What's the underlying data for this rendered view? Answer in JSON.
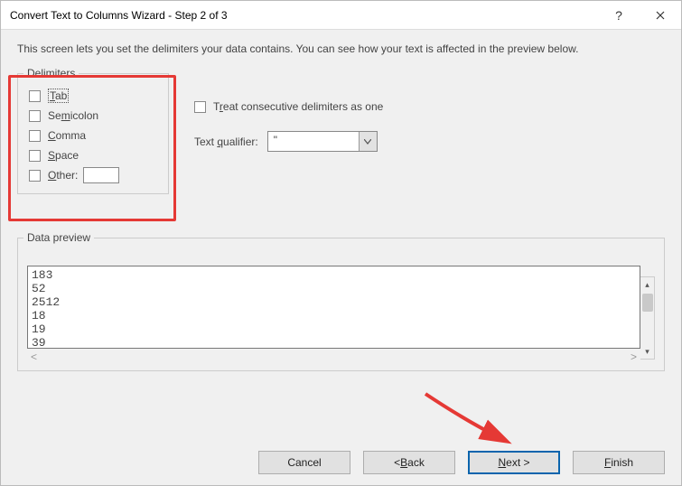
{
  "title": "Convert Text to Columns Wizard - Step 2 of 3",
  "description": "This screen lets you set the delimiters your data contains.  You can see how your text is affected in the preview below.",
  "delimiters": {
    "legend": "Delimiters",
    "tab": "Tab",
    "semicolon": "Semicolon",
    "comma": "Comma",
    "space": "Space",
    "other": "Other:"
  },
  "options": {
    "consecutive": "Treat consecutive delimiters as one",
    "qualifier_label": "Text qualifier:",
    "qualifier_value": "\""
  },
  "preview": {
    "legend": "Data preview",
    "rows": "183\n52\n2512\n18\n19\n39"
  },
  "buttons": {
    "cancel": "Cancel",
    "back": "< Back",
    "next": "Next >",
    "finish": "Finish"
  }
}
